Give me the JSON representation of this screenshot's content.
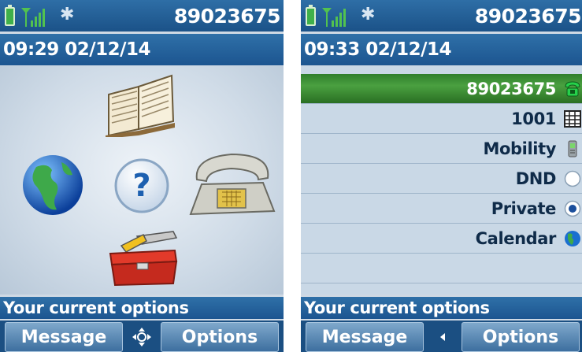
{
  "left_screen": {
    "status": {
      "number": "89023675",
      "battery_icon": "battery-icon",
      "signal_icon": "signal-icon",
      "bluetooth_icon": "bluetooth-icon"
    },
    "datetime": "09:29 02/12/14",
    "menu_icons": [
      "book-icon",
      "globe-icon",
      "help-icon",
      "telephone-icon",
      "toolbox-icon"
    ],
    "footer_text": "Your current options",
    "softkeys": {
      "left": "Message",
      "right": "Options",
      "nav_icon": "navigation-cross-icon"
    }
  },
  "right_screen": {
    "status": {
      "number": "89023675",
      "battery_icon": "battery-icon",
      "signal_icon": "signal-icon",
      "bluetooth_icon": "bluetooth-icon"
    },
    "datetime": "09:33 02/12/14",
    "items": [
      {
        "label": "89023675",
        "icon": "phone-icon"
      },
      {
        "label": "1001",
        "icon": "keypad-icon"
      },
      {
        "label": "Mobility",
        "icon": "mobile-phone-icon"
      },
      {
        "label": "DND",
        "icon": "radio-empty-icon"
      },
      {
        "label": "Private",
        "icon": "radio-selected-icon"
      },
      {
        "label": "Calendar",
        "icon": "calendar-globe-icon"
      }
    ],
    "footer_text": "Your current options",
    "softkeys": {
      "left": "Message",
      "right": "Options",
      "nav_icon": "left-arrow-icon"
    }
  },
  "colors": {
    "header_blue": "#1f5a94",
    "selected_green": "#3a8f33",
    "list_bg": "#c9d8e6"
  }
}
